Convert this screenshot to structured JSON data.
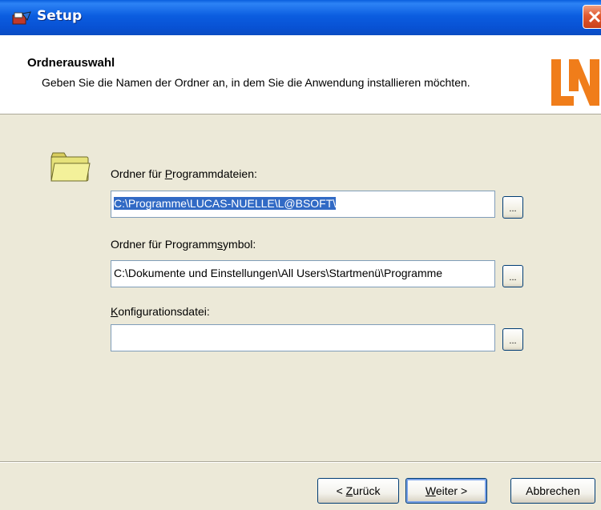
{
  "window": {
    "title": "Setup"
  },
  "header": {
    "title": "Ordnerauswahl",
    "description": "Geben Sie die Namen der Ordner an, in dem Sie die Anwendung installieren möchten.",
    "logo_text": "LN",
    "logo_color": "#f07d1a"
  },
  "fields": {
    "program_files": {
      "label_pre": "Ordner für ",
      "label_accel": "P",
      "label_post": "rogrammdateien:",
      "value": "C:\\Programme\\LUCAS-NUELLE\\L@BSOFT\\"
    },
    "program_symbol": {
      "label_pre": "Ordner für Programm",
      "label_accel": "s",
      "label_post": "ymbol:",
      "value": "C:\\Dokumente und Einstellungen\\All Users\\Startmenü\\Programme"
    },
    "config_file": {
      "label_pre": "",
      "label_accel": "K",
      "label_post": "onfigurationsdatei:",
      "value": ""
    },
    "browse_label": "..."
  },
  "buttons": {
    "back_pre": "< ",
    "back_accel": "Z",
    "back_post": "urück",
    "next_accel": "W",
    "next_post": "eiter >",
    "cancel": "Abbrechen"
  },
  "icons": {
    "app": "setup-app-icon",
    "close": "close-icon",
    "folder": "folder-icon"
  }
}
